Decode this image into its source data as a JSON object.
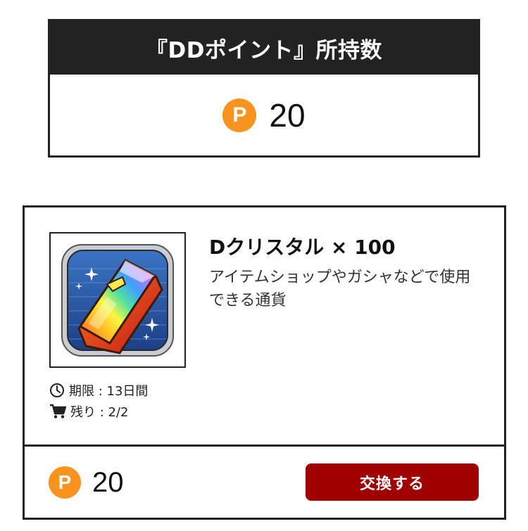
{
  "points_panel": {
    "title": "『DDポイント』所持数",
    "icon_label": "P",
    "value": "20"
  },
  "item": {
    "name": "Dクリスタル × 100",
    "description": "アイテムショップやガシャなどで使用できる通貨",
    "image_icon": "d-crystal-icon",
    "deadline": "期限 : 13日間",
    "remaining": "残り : 2/2",
    "cost_icon_label": "P",
    "cost": "20",
    "exchange_label": "交換する"
  },
  "colors": {
    "header_bg": "#222222",
    "point_icon": "#f7931e",
    "exchange_button": "#a00000"
  }
}
